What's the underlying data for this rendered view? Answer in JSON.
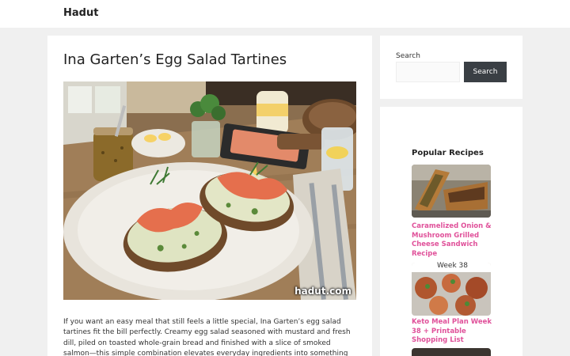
{
  "site": {
    "title": "Hadut"
  },
  "post": {
    "title": "Ina Garten’s Egg Salad Tartines",
    "watermark": "hadut.com",
    "body": "If you want an easy meal that still feels a little special, Ina Garten’s egg salad tartines fit the bill perfectly. Creamy egg salad seasoned with mustard and fresh dill, piled on toasted whole-grain bread and finished with a slice of smoked salmon—this simple combination elevates everyday ingredients into something you’ll enjoy anytime. I first"
  },
  "search": {
    "label": "Search",
    "input_value": "",
    "button_label": "Search"
  },
  "sidebar": {
    "widget_title": "Popular Recipes",
    "recipes": [
      {
        "title": "Caramelized Onion & Mushroom Grilled Cheese Sandwich Recipe"
      },
      {
        "title": "Keto Meal Plan Week 38 + Printable Shopping List",
        "thumb_text": "Week 38"
      }
    ]
  },
  "colors": {
    "link": "#e0519a",
    "button": "#3a3f44",
    "page_bg": "#f0f0f0"
  }
}
